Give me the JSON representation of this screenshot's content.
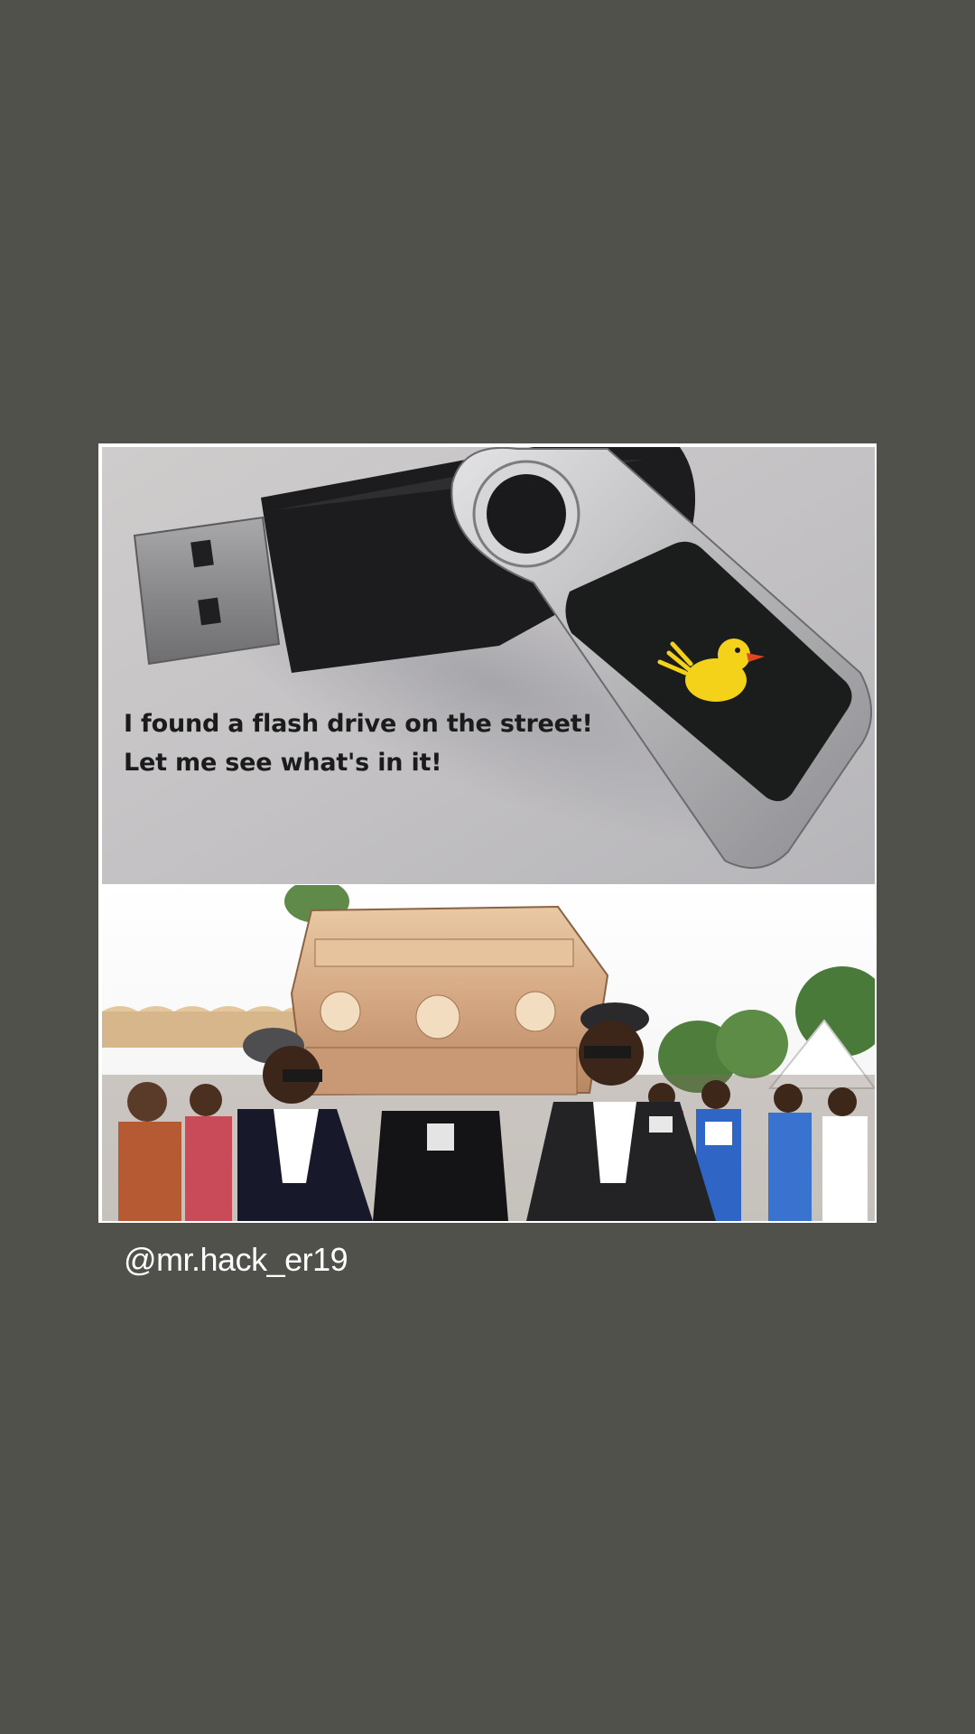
{
  "meme": {
    "caption_line1": "I found a flash drive on the street!",
    "caption_line2": "Let me see what's in it!",
    "top_image": "usb-flash-drive-with-duck-sticker",
    "bottom_image": "coffin-dance-pallbearers"
  },
  "post": {
    "watermark": "@mr.hack_er19"
  },
  "colors": {
    "background": "#50514b",
    "card": "#ffffff",
    "duck": "#f5d21a"
  }
}
